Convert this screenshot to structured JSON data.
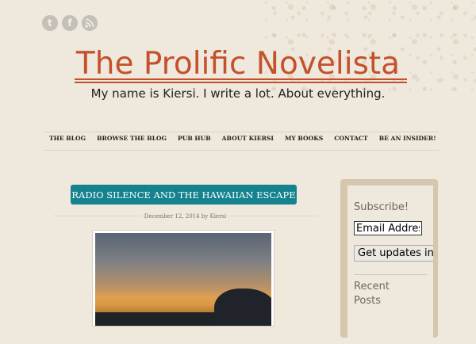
{
  "social": [
    {
      "icon": "twitter-icon",
      "glyph": "t"
    },
    {
      "icon": "facebook-icon",
      "glyph": "f"
    },
    {
      "icon": "rss-icon",
      "glyph": ")"
    }
  ],
  "header": {
    "title": "The Prolific Novelista",
    "tagline": "My name is Kiersi. I write a lot. About everything."
  },
  "nav": [
    "THE BLOG",
    "BROWSE THE BLOG",
    "PUB HUB",
    "ABOUT KIERSI",
    "MY BOOKS",
    "CONTACT",
    "BE AN INSIDER!"
  ],
  "post": {
    "title": "RADIO SILENCE AND THE HAWAIIAN ESCAPE",
    "meta": "December 12, 2014 by Kiersi"
  },
  "sidebar": {
    "subscribe_title": "Subscribe!",
    "email_value": "Email Address",
    "submit_label": "Get updates in my email",
    "recent_title_line1": "Recent",
    "recent_title_line2": "Posts"
  },
  "colors": {
    "accent": "#c4512c",
    "teal": "#14838f",
    "background": "#efe8dc"
  }
}
